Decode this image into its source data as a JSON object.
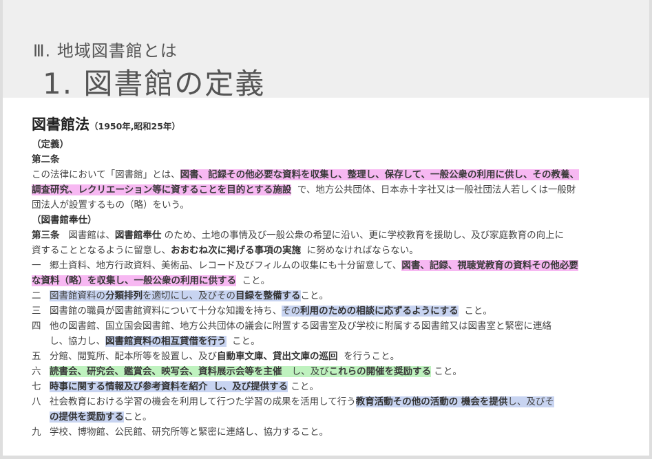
{
  "header": {
    "section_title": "Ⅲ. 地域図書館とは",
    "main_title": "1. 図書館の定義"
  },
  "law": {
    "name": "図書館法",
    "year": "（1950年,昭和25年）",
    "def_heading": "（定義）",
    "art2_label": "第二条",
    "art2_l1a": "この法律において「図書館」とは、",
    "art2_l1b": "図書、記録その他必要な資料を収集し、整理し、保存して、一般公衆の利用に供し、その教養、",
    "art2_l2a": "調査研究、レクリエーション等に資することを目的とする施設",
    "art2_l2b": "で、地方公共団体、日本赤十字社又は一般社団法人若しくは一般財",
    "art2_l3": "団法人が設置するもの（略）をいう。",
    "service_heading": "（図書館奉仕）",
    "art3_label": "第三条",
    "art3_l1a": "図書館は、",
    "art3_l1b": "図書館奉仕",
    "art3_l1c": "のため、土地の事情及び一般公衆の希望に沿い、更に学校教育を援助し、及び家庭教育の向上に",
    "art3_l2a": "資することとなるように留意し、",
    "art3_l2b": "おおむね次に掲げる事項の実施",
    "art3_l2c": "に努めなければならない。"
  },
  "items": [
    {
      "num": "一",
      "l1a": "郷土資料、地方行政資料、美術品、レコード及びフィルムの収集にも十分留意して、",
      "l1b": "図書、記録、視聴覚教育の資料その他必要",
      "l2a": "な資料（略）を収集し、一般公衆の利用に供する",
      "l2b": "こと。"
    },
    {
      "num": "二",
      "a": "図書館資料の",
      "b": "分類排列",
      "c": "を適切にし、及びその",
      "d": "目録を整備する",
      "e": "こと。"
    },
    {
      "num": "三",
      "a": "図書館の職員が図書館資料について十分な知識を持ち、",
      "b": "その",
      "c": "利用のための相談に応ずるようにする",
      "d": "こと。"
    },
    {
      "num": "四",
      "l1": "他の図書館、国立国会図書館、地方公共団体の議会に附置する図書室及び学校に附属する図書館又は図書室と緊密に連絡",
      "l2a": "し、協力し、",
      "l2b": "図書館資料の相互貸借を行う",
      "l2c": "こと。"
    },
    {
      "num": "五",
      "a": "分館、閲覧所、配本所等を設置し、及び",
      "b": "自動車文庫、貸出文庫の巡回",
      "c": "を行うこと。"
    },
    {
      "num": "六",
      "a": "読書会、研究会、鑑賞会、映写会、資料展示会等を主催",
      "b": "し、及び",
      "c": "これらの開催を奨励する",
      "d": "こと。"
    },
    {
      "num": "七",
      "a": "時事に関する情報及び参考資料を紹介",
      "b": "し、及び提供する",
      "c": "こと。"
    },
    {
      "num": "八",
      "l1a": "社会教育における学習の機会を利用して行つた学習の成果を活用して行う",
      "l1b": "教育活動その他の活動の 機会を提供",
      "l1c": "し、及びそ",
      "l2a": "の提供を奨励する",
      "l2b": "こと。"
    },
    {
      "num": "九",
      "a": "学校、博物館、公民館、研究所等と緊密に連絡し、協力すること。"
    }
  ]
}
